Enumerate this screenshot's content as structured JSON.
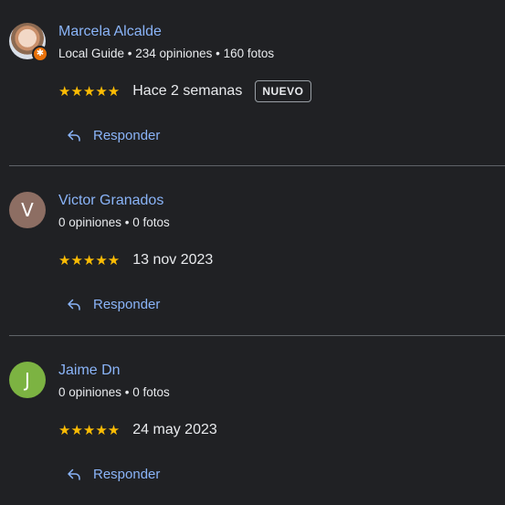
{
  "reviews": [
    {
      "name": "Marcela Alcalde",
      "meta": "Local Guide • 234 opiniones • 160 fotos",
      "avatar_initial": "",
      "avatar_color": "",
      "stars": "★★★★★",
      "rating": 5,
      "date": "Hace 2 semanas",
      "badge": "NUEVO",
      "reply_label": "Responder"
    },
    {
      "name": "Victor Granados",
      "meta": "0 opiniones • 0 fotos",
      "avatar_initial": "V",
      "avatar_color": "#8d6e63",
      "stars": "★★★★★",
      "rating": 5,
      "date": "13 nov 2023",
      "reply_label": "Responder"
    },
    {
      "name": "Jaime Dn",
      "meta": "0 opiniones • 0 fotos",
      "avatar_initial": "J",
      "avatar_color": "#7cb342",
      "stars": "★★★★★",
      "rating": 5,
      "date": "24 may 2023",
      "reply_label": "Responder"
    }
  ],
  "colors": {
    "background": "#202124",
    "link": "#8ab4f8",
    "star": "#fbbc04",
    "text": "#e8eaed",
    "divider": "#5f6368"
  },
  "icons": {
    "reply": "reply-arrow-icon",
    "star": "star-icon",
    "local_guide": "local-guide-badge-icon"
  }
}
